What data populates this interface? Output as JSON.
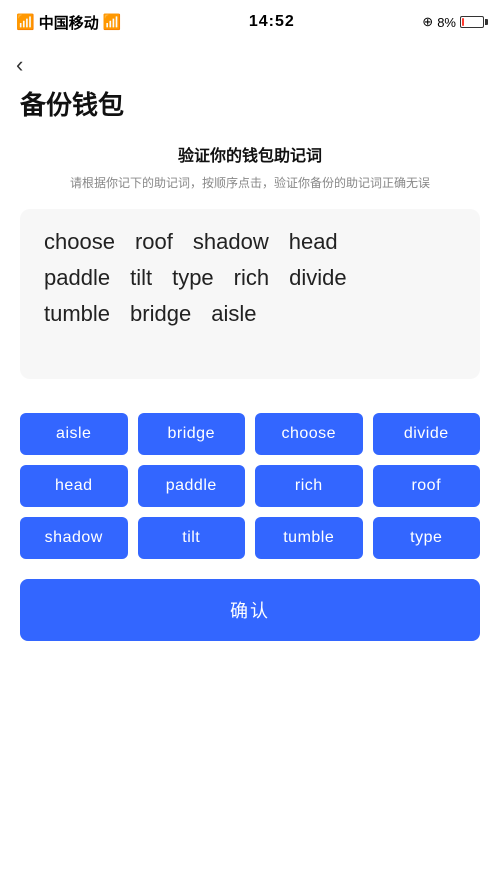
{
  "statusBar": {
    "carrier": "中国移动",
    "time": "14:52",
    "batteryPercent": "8%"
  },
  "back": {
    "label": "‹"
  },
  "pageTitle": "备份钱包",
  "sectionHeading": "验证你的钱包助记词",
  "sectionDesc": "请根据你记下的助记词，按顺序点击，验证你备份的助记词正确无误",
  "displayWords": [
    {
      "text": "choose"
    },
    {
      "text": "roof"
    },
    {
      "text": "shadow"
    },
    {
      "text": "head"
    },
    {
      "text": "paddle"
    },
    {
      "text": "tilt"
    },
    {
      "text": "type"
    },
    {
      "text": "rich"
    },
    {
      "text": "divide"
    },
    {
      "text": "tumble"
    },
    {
      "text": "bridge"
    },
    {
      "text": "aisle"
    }
  ],
  "wordButtons": [
    "aisle",
    "bridge",
    "choose",
    "divide",
    "head",
    "paddle",
    "rich",
    "roof",
    "shadow",
    "tilt",
    "tumble",
    "type"
  ],
  "confirmButton": "确认"
}
